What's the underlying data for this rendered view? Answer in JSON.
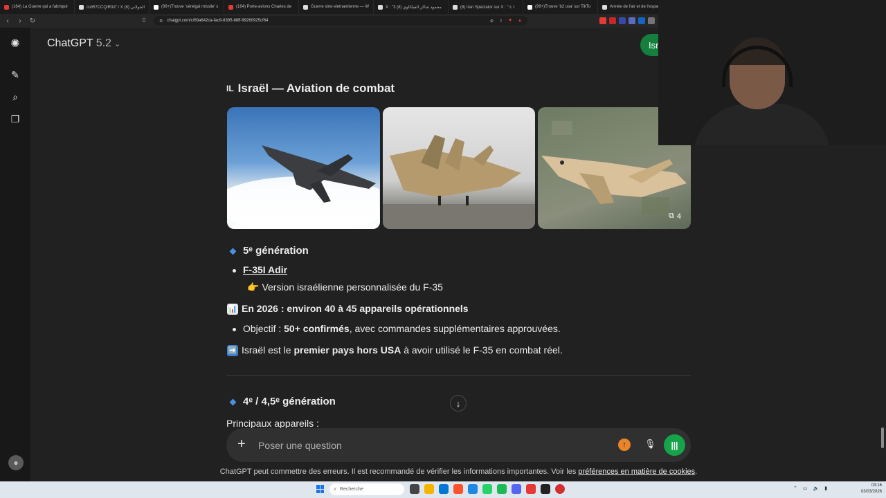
{
  "browser": {
    "tabs": [
      {
        "title": "(164) La Guerre qui a fabriqué",
        "color": "#e53935"
      },
      {
        "title": "co/R7CCQ/R0d\" / X (8) الجولاني",
        "color": "#dddddd"
      },
      {
        "title": "(99+)Trouve 'sénégal missile' s",
        "color": "#ffffff"
      },
      {
        "title": "(164) Porte-avions Charles de",
        "color": "#e53935"
      },
      {
        "title": "Guerre sino-vietnamienne — W",
        "color": "#dddddd"
      },
      {
        "title": "X : \"3 محمود شاكر الفيلكاوي (8)",
        "color": "#dddddd"
      },
      {
        "title": "(8) Iran Spectator sur X : \"⚠ I",
        "color": "#dddddd"
      },
      {
        "title": "(99+)Trouve 'b2 usa' sur TikTo",
        "color": "#ffffff"
      },
      {
        "title": "Armée de l'air et de l'espace",
        "color": "#dddddd"
      }
    ],
    "url": "chatgpt.com/c/69a642ca-fac8-8395-88ff-99260925cf64"
  },
  "header": {
    "model_name": "ChatGPT",
    "model_version": "5.2",
    "share_label": "Isr"
  },
  "sidebar": {
    "icons": [
      "openai-logo-icon",
      "new-chat-icon",
      "search-icon",
      "library-icon"
    ]
  },
  "message": {
    "section_flag": "IL",
    "section_title": "Israël — Aviation de combat",
    "gallery_count": "4",
    "gen5_heading": "5ᵉ génération",
    "f35_link": "F-35I Adir",
    "f35_desc_emoji": "👉",
    "f35_desc": "Version israélienne personnalisée du F-35",
    "stats_emoji": "📊",
    "stats_line": "En 2026 : environ 40 à 45 appareils opérationnels",
    "objective_prefix": "Objectif : ",
    "objective_bold": "50+ confirmés",
    "objective_suffix": ", avec commandes supplémentaires approuvées.",
    "arrow_emoji": "➡️",
    "fact_prefix": "Israël est le ",
    "fact_bold": "premier pays hors USA",
    "fact_suffix": " à avoir utilisé le F-35 en combat réel.",
    "gen4_heading": "4ᵉ / 4,5ᵉ génération",
    "main_devices": "Principaux appareils :"
  },
  "composer": {
    "placeholder": "Poser une question"
  },
  "disclaimer": {
    "text": "ChatGPT peut commettre des erreurs. Il est recommandé de vérifier les informations importantes. Voir les ",
    "link": "préférences en matière de cookies",
    "end": "."
  },
  "taskbar": {
    "search_placeholder": "Recherche",
    "time": "03:16",
    "date": "03/03/2026"
  }
}
